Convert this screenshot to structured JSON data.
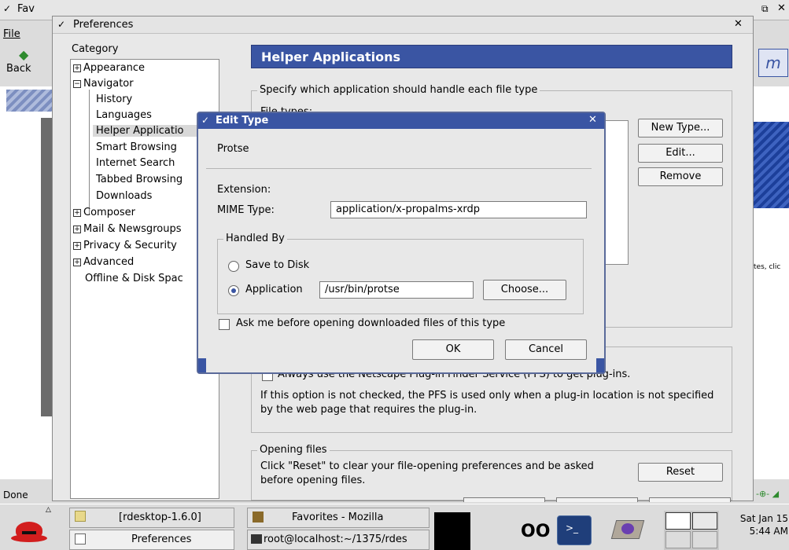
{
  "background_browser": {
    "title": "Fav",
    "menu_file": "File",
    "back_label": "Back",
    "status": "Done",
    "right_snippet": "tes, clic"
  },
  "prefs": {
    "title": "Preferences",
    "category_label": "Category",
    "tree": [
      {
        "label": "Appearance",
        "expander": "+",
        "indent": 0
      },
      {
        "label": "Navigator",
        "expander": "-",
        "indent": 0
      },
      {
        "label": "History",
        "indent": 1
      },
      {
        "label": "Languages",
        "indent": 1
      },
      {
        "label": "Helper Applicatio",
        "indent": 1,
        "selected": true
      },
      {
        "label": "Smart Browsing",
        "indent": 1
      },
      {
        "label": "Internet Search",
        "indent": 1
      },
      {
        "label": "Tabbed Browsing",
        "indent": 1
      },
      {
        "label": "Downloads",
        "indent": 1
      },
      {
        "label": "Composer",
        "expander": "+",
        "indent": 0
      },
      {
        "label": "Mail & Newsgroups",
        "expander": "+",
        "indent": 0
      },
      {
        "label": "Privacy & Security",
        "expander": "+",
        "indent": 0
      },
      {
        "label": "Advanced",
        "expander": "+",
        "indent": 0
      },
      {
        "label": "Offline & Disk Spac",
        "indent": 0
      }
    ],
    "panel_title": "Helper Applications",
    "specify_legend": "Specify which application should handle each file type",
    "file_types_label": "File types:",
    "new_type_btn": "New Type...",
    "edit_btn": "Edit...",
    "remove_btn": "Remove",
    "plugin_checkbox_label": "Always use the Netscape Plug-in Finder Service (PFS) to get plug-ins.",
    "plugin_desc": "If this option is not checked, the PFS is used only when a plug-in location is not specified by the web page that requires the plug-in.",
    "opening_legend": "Opening files",
    "opening_desc": "Click \"Reset\" to clear your file-opening preferences and be asked before opening files.",
    "reset_btn": "Reset"
  },
  "dialog": {
    "title": "Edit Type",
    "type_name": "Protse",
    "extension_label": "Extension:",
    "mime_label": "MIME Type:",
    "mime_value": "application/x-propalms-xrdp",
    "handled_by_legend": "Handled By",
    "save_to_disk_label": "Save to Disk",
    "application_label": "Application",
    "application_path": "/usr/bin/protse",
    "choose_btn": "Choose...",
    "ask_label": "Ask me before opening downloaded files of this type",
    "ok_btn": "OK",
    "cancel_btn": "Cancel",
    "selected_handler": "application"
  },
  "taskbar": {
    "tasks": [
      "[rdesktop-1.6.0]",
      "Favorites - Mozilla",
      "Preferences",
      "root@localhost:~/1375/rdes"
    ],
    "clock_day": "Sat Jan 15",
    "clock_time": "5:44 AM"
  },
  "colors": {
    "accent": "#3a55a3",
    "dialog_border": "#5a6a9a"
  }
}
